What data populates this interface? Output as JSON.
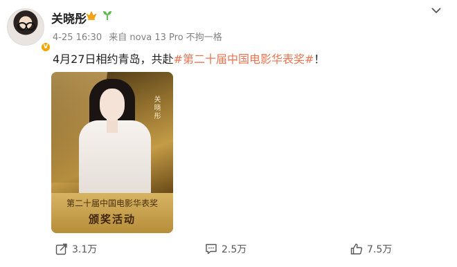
{
  "user": {
    "name": "关晓彤",
    "meta": {
      "date": "4-25 16:30",
      "source": "来自 nova 13 Pro 不拘一格"
    }
  },
  "post": {
    "text_prefix": "4月27日相约青岛，共赴",
    "hashtag": "#第二十届中国电影华表奖#",
    "text_suffix": "！"
  },
  "poster": {
    "side_name": "关晓彤",
    "title": "第二十届中国电影华表奖",
    "subtitle": "颁奖活动"
  },
  "actions": {
    "repost": "3.1万",
    "comment": "2.5万",
    "like": "7.5万"
  },
  "colors": {
    "hashtag": "#eb7350",
    "verified": "#f7a300"
  }
}
